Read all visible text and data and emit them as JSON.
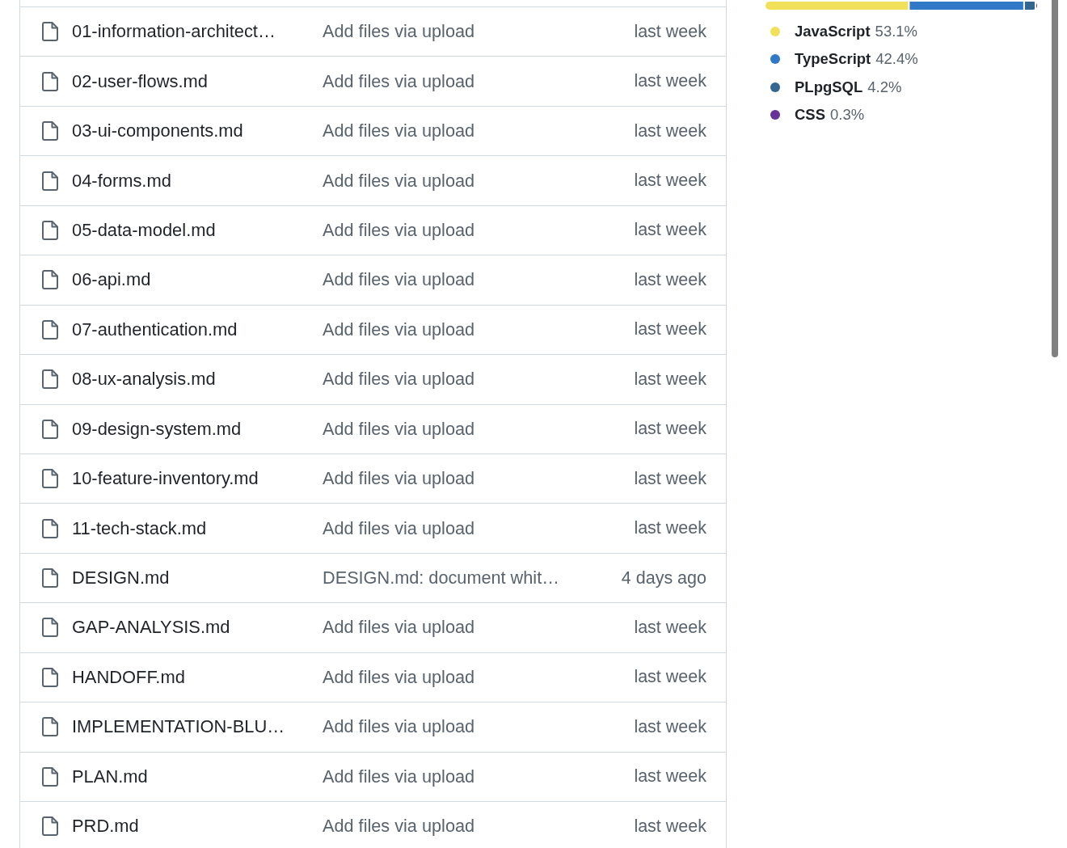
{
  "files": [
    {
      "name": "01-information-architect…",
      "message": "Add files via upload",
      "updated": "last week"
    },
    {
      "name": "02-user-flows.md",
      "message": "Add files via upload",
      "updated": "last week"
    },
    {
      "name": "03-ui-components.md",
      "message": "Add files via upload",
      "updated": "last week"
    },
    {
      "name": "04-forms.md",
      "message": "Add files via upload",
      "updated": "last week"
    },
    {
      "name": "05-data-model.md",
      "message": "Add files via upload",
      "updated": "last week"
    },
    {
      "name": "06-api.md",
      "message": "Add files via upload",
      "updated": "last week"
    },
    {
      "name": "07-authentication.md",
      "message": "Add files via upload",
      "updated": "last week"
    },
    {
      "name": "08-ux-analysis.md",
      "message": "Add files via upload",
      "updated": "last week"
    },
    {
      "name": "09-design-system.md",
      "message": "Add files via upload",
      "updated": "last week"
    },
    {
      "name": "10-feature-inventory.md",
      "message": "Add files via upload",
      "updated": "last week"
    },
    {
      "name": "11-tech-stack.md",
      "message": "Add files via upload",
      "updated": "last week"
    },
    {
      "name": "DESIGN.md",
      "message": "DESIGN.md: document whit…",
      "updated": "4 days ago"
    },
    {
      "name": "GAP-ANALYSIS.md",
      "message": "Add files via upload",
      "updated": "last week"
    },
    {
      "name": "HANDOFF.md",
      "message": "Add files via upload",
      "updated": "last week"
    },
    {
      "name": "IMPLEMENTATION-BLU…",
      "message": "Add files via upload",
      "updated": "last week"
    },
    {
      "name": "PLAN.md",
      "message": "Add files via upload",
      "updated": "last week"
    },
    {
      "name": "PRD.md",
      "message": "Add files via upload",
      "updated": "last week"
    }
  ],
  "languages": [
    {
      "name": "JavaScript",
      "percent": "53.1%",
      "color": "#f1e05a"
    },
    {
      "name": "TypeScript",
      "percent": "42.4%",
      "color": "#3178c6"
    },
    {
      "name": "PLpgSQL",
      "percent": "4.2%",
      "color": "#336790"
    },
    {
      "name": "CSS",
      "percent": "0.3%",
      "color": "#663399"
    }
  ]
}
